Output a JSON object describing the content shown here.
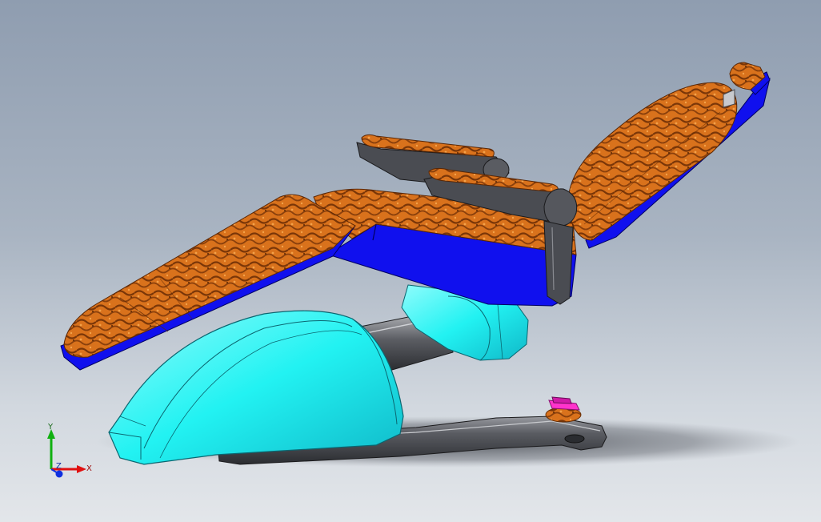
{
  "viewport": {
    "background_top": "#8f9db0",
    "background_bottom": "#e3e6ea"
  },
  "model": {
    "colors": {
      "upholstery": "#d9721c",
      "upholstery_dark": "#7a3608",
      "frame_blue": "#1010ee",
      "base_cyan": "#22f2f2",
      "metal_grey": "#4a4c52",
      "control_pink": "#ff33cc"
    }
  },
  "triad": {
    "x_label": "X",
    "y_label": "Y",
    "z_label": "Z",
    "x_color": "#e01010",
    "y_color": "#10b010",
    "z_color": "#1030e0"
  }
}
